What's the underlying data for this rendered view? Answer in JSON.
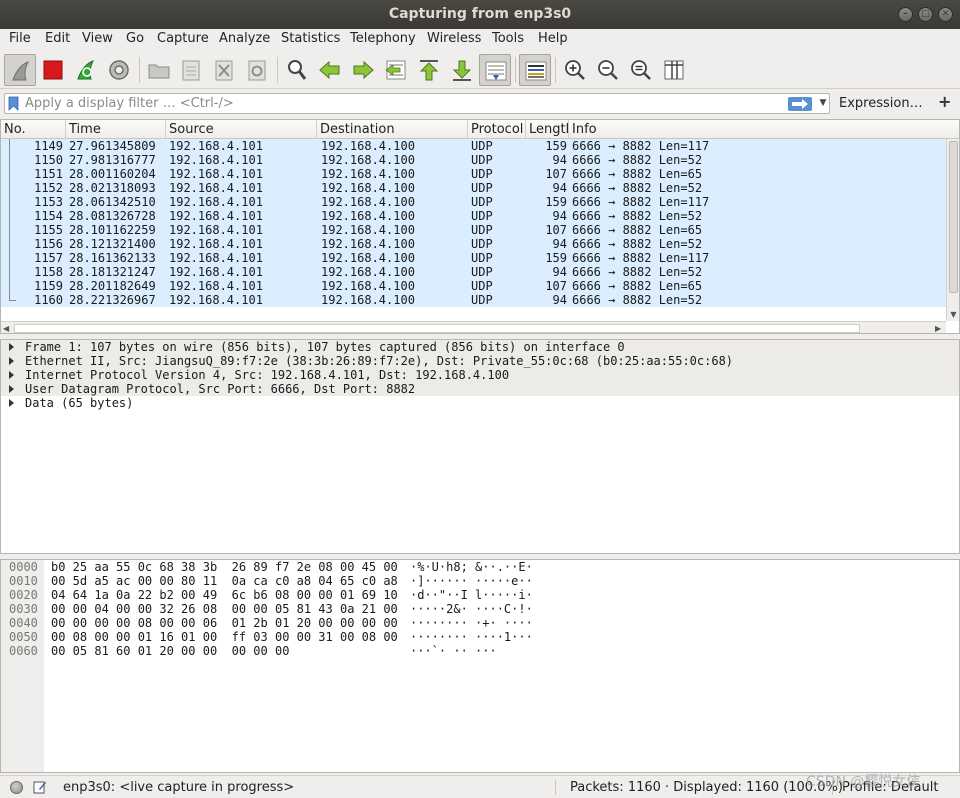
{
  "window": {
    "title": "Capturing from enp3s0"
  },
  "menu": [
    "File",
    "Edit",
    "View",
    "Go",
    "Capture",
    "Analyze",
    "Statistics",
    "Telephony",
    "Wireless",
    "Tools",
    "Help"
  ],
  "toolbar_icons": [
    "shark-fin-start-icon",
    "stop-capture-icon",
    "restart-capture-icon",
    "capture-options-icon",
    "open-file-icon",
    "save-file-icon",
    "close-file-icon",
    "reload-file-icon",
    "find-packet-icon",
    "go-back-icon",
    "go-forward-icon",
    "go-to-packet-icon",
    "go-first-icon",
    "go-last-icon",
    "autoscroll-icon",
    "colorize-icon",
    "zoom-in-icon",
    "zoom-out-icon",
    "zoom-normal-icon",
    "resize-columns-icon"
  ],
  "filter": {
    "placeholder": "Apply a display filter … <Ctrl-/>",
    "value": "",
    "expression_label": "Expression…",
    "add_label": "+"
  },
  "packet_list": {
    "columns": [
      "No.",
      "Time",
      "Source",
      "Destination",
      "Protocol",
      "Length",
      "Info"
    ],
    "rows": [
      {
        "no": "1149",
        "time": "27.961345809",
        "src": "192.168.4.101",
        "dst": "192.168.4.100",
        "proto": "UDP",
        "len": "159",
        "info": "6666 → 8882 Len=117"
      },
      {
        "no": "1150",
        "time": "27.981316777",
        "src": "192.168.4.101",
        "dst": "192.168.4.100",
        "proto": "UDP",
        "len": "94",
        "info": "6666 → 8882 Len=52"
      },
      {
        "no": "1151",
        "time": "28.001160204",
        "src": "192.168.4.101",
        "dst": "192.168.4.100",
        "proto": "UDP",
        "len": "107",
        "info": "6666 → 8882 Len=65"
      },
      {
        "no": "1152",
        "time": "28.021318093",
        "src": "192.168.4.101",
        "dst": "192.168.4.100",
        "proto": "UDP",
        "len": "94",
        "info": "6666 → 8882 Len=52"
      },
      {
        "no": "1153",
        "time": "28.061342510",
        "src": "192.168.4.101",
        "dst": "192.168.4.100",
        "proto": "UDP",
        "len": "159",
        "info": "6666 → 8882 Len=117"
      },
      {
        "no": "1154",
        "time": "28.081326728",
        "src": "192.168.4.101",
        "dst": "192.168.4.100",
        "proto": "UDP",
        "len": "94",
        "info": "6666 → 8882 Len=52"
      },
      {
        "no": "1155",
        "time": "28.101162259",
        "src": "192.168.4.101",
        "dst": "192.168.4.100",
        "proto": "UDP",
        "len": "107",
        "info": "6666 → 8882 Len=65"
      },
      {
        "no": "1156",
        "time": "28.121321400",
        "src": "192.168.4.101",
        "dst": "192.168.4.100",
        "proto": "UDP",
        "len": "94",
        "info": "6666 → 8882 Len=52"
      },
      {
        "no": "1157",
        "time": "28.161362133",
        "src": "192.168.4.101",
        "dst": "192.168.4.100",
        "proto": "UDP",
        "len": "159",
        "info": "6666 → 8882 Len=117"
      },
      {
        "no": "1158",
        "time": "28.181321247",
        "src": "192.168.4.101",
        "dst": "192.168.4.100",
        "proto": "UDP",
        "len": "94",
        "info": "6666 → 8882 Len=52"
      },
      {
        "no": "1159",
        "time": "28.201182649",
        "src": "192.168.4.101",
        "dst": "192.168.4.100",
        "proto": "UDP",
        "len": "107",
        "info": "6666 → 8882 Len=65"
      },
      {
        "no": "1160",
        "time": "28.221326967",
        "src": "192.168.4.101",
        "dst": "192.168.4.100",
        "proto": "UDP",
        "len": "94",
        "info": "6666 → 8882 Len=52"
      }
    ]
  },
  "details": [
    "Frame 1: 107 bytes on wire (856 bits), 107 bytes captured (856 bits) on interface 0",
    "Ethernet II, Src: JiangsuQ_89:f7:2e (38:3b:26:89:f7:2e), Dst: Private_55:0c:68 (b0:25:aa:55:0c:68)",
    "Internet Protocol Version 4, Src: 192.168.4.101, Dst: 192.168.4.100",
    "User Datagram Protocol, Src Port: 6666, Dst Port: 8882",
    "Data (65 bytes)"
  ],
  "bytes": [
    {
      "offset": "0000",
      "hex": "b0 25 aa 55 0c 68 38 3b  26 89 f7 2e 08 00 45 00",
      "ascii": "·%·U·h8; &··.··E·"
    },
    {
      "offset": "0010",
      "hex": "00 5d a5 ac 00 00 80 11  0a ca c0 a8 04 65 c0 a8",
      "ascii": "·]······ ·····e··"
    },
    {
      "offset": "0020",
      "hex": "04 64 1a 0a 22 b2 00 49  6c b6 08 00 00 01 69 10",
      "ascii": "·d··\"··I l·····i·"
    },
    {
      "offset": "0030",
      "hex": "00 00 04 00 00 32 26 08  00 00 05 81 43 0a 21 00",
      "ascii": "·····2&· ····C·!·"
    },
    {
      "offset": "0040",
      "hex": "00 00 00 00 08 00 00 06  01 2b 01 20 00 00 00 00",
      "ascii": "········ ·+· ····"
    },
    {
      "offset": "0050",
      "hex": "00 08 00 00 01 16 01 00  ff 03 00 00 31 00 08 00",
      "ascii": "········ ····1···"
    },
    {
      "offset": "0060",
      "hex": "00 05 81 60 01 20 00 00  00 00 00",
      "ascii": "···`· ·· ···"
    }
  ],
  "status": {
    "capture_text": "enp3s0: <live capture in progress>",
    "packets_text": "Packets: 1160 · Displayed: 1160 (100.0%)",
    "profile_text": "Profile: Default"
  },
  "watermark": "CSDN @樱悦女侠",
  "colors": {
    "row_bg": "#daeeff",
    "titlebar": "#3f3e39",
    "apply_button": "#5a8fd2",
    "stop_red": "#d8181b"
  }
}
